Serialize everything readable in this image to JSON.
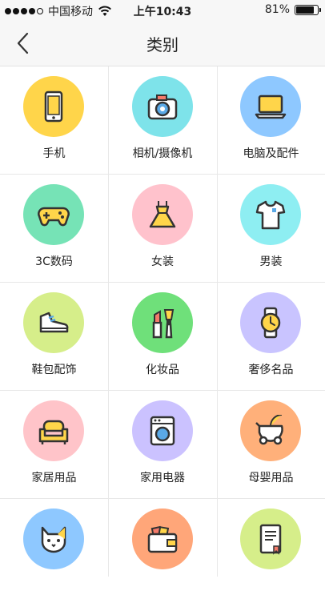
{
  "status_bar": {
    "carrier": "中国移动",
    "time": "上午10:43",
    "battery": "81%"
  },
  "nav": {
    "title": "类别"
  },
  "categories": [
    {
      "label": "手机",
      "icon": "phone-icon",
      "color": "#ffd54a"
    },
    {
      "label": "相机/摄像机",
      "icon": "camera-icon",
      "color": "#7ee3ea"
    },
    {
      "label": "电脑及配件",
      "icon": "laptop-icon",
      "color": "#8ec8ff"
    },
    {
      "label": "3C数码",
      "icon": "gamepad-icon",
      "color": "#76e3b6"
    },
    {
      "label": "女装",
      "icon": "dress-icon",
      "color": "#ffc2cc"
    },
    {
      "label": "男装",
      "icon": "tshirt-icon",
      "color": "#8eeef2"
    },
    {
      "label": "鞋包配饰",
      "icon": "sneaker-icon",
      "color": "#d6ee8a"
    },
    {
      "label": "化妆品",
      "icon": "makeup-icon",
      "color": "#6fe07a"
    },
    {
      "label": "奢侈名品",
      "icon": "watch-icon",
      "color": "#c9c4ff"
    },
    {
      "label": "家居用品",
      "icon": "sofa-icon",
      "color": "#ffc4c9"
    },
    {
      "label": "家用电器",
      "icon": "washing-machine-icon",
      "color": "#cbc2ff"
    },
    {
      "label": "母婴用品",
      "icon": "stroller-icon",
      "color": "#ffb07a"
    },
    {
      "label": "",
      "icon": "cat-icon",
      "color": "#8ec8ff"
    },
    {
      "label": "",
      "icon": "wallet-icon",
      "color": "#ffa679"
    },
    {
      "label": "",
      "icon": "book-icon",
      "color": "#d6ee8a"
    }
  ]
}
